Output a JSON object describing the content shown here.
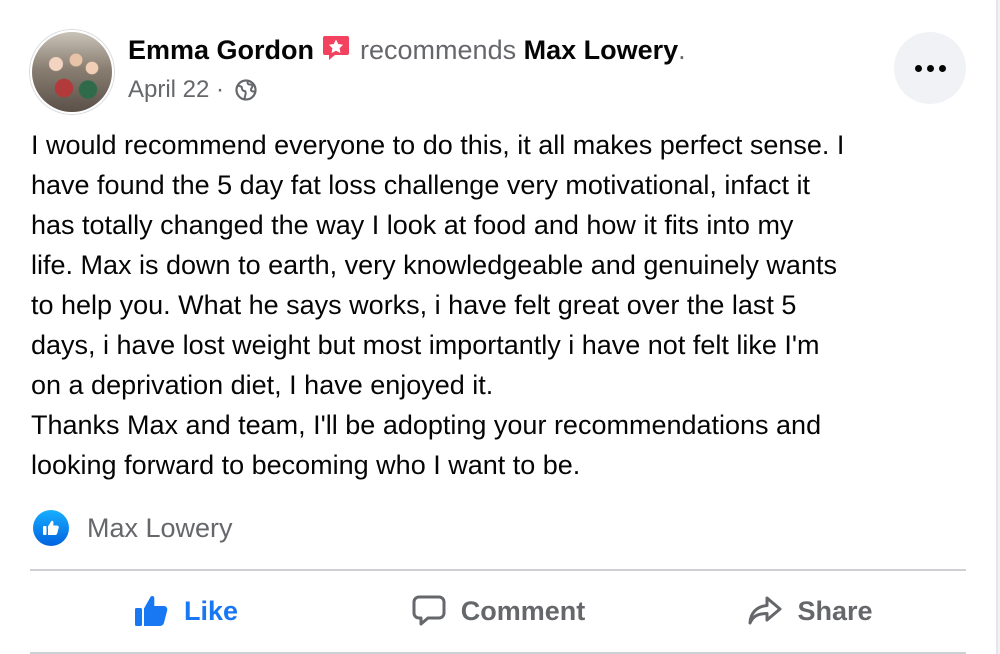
{
  "post": {
    "author": "Emma Gordon",
    "verb": "recommends",
    "target": "Max Lowery",
    "period": ".",
    "date": "April 22",
    "separator": "·",
    "privacy_icon": "globe-icon",
    "body": "I would recommend everyone to do this, it all makes perfect sense. I\nhave found the 5 day fat loss challenge very motivational, infact it\nhas totally changed the way I look at food and how it fits into my\nlife. Max is down to earth, very knowledgeable and genuinely wants\nto help you. What he says works, i have felt great over the last 5\ndays, i have lost weight but most importantly i have not felt like I'm\non a deprivation diet, I have enjoyed it.\nThanks Max and team, I'll be adopting your recommendations and\nlooking forward to becoming who I want to be."
  },
  "reactions": {
    "icon": "like-reaction-icon",
    "names": "Max Lowery"
  },
  "actions": {
    "like": "Like",
    "comment": "Comment",
    "share": "Share"
  },
  "colors": {
    "accent": "#1877f2",
    "recommend_badge": "#f3425f",
    "secondary_text": "#65676b",
    "primary_text": "#050505"
  }
}
